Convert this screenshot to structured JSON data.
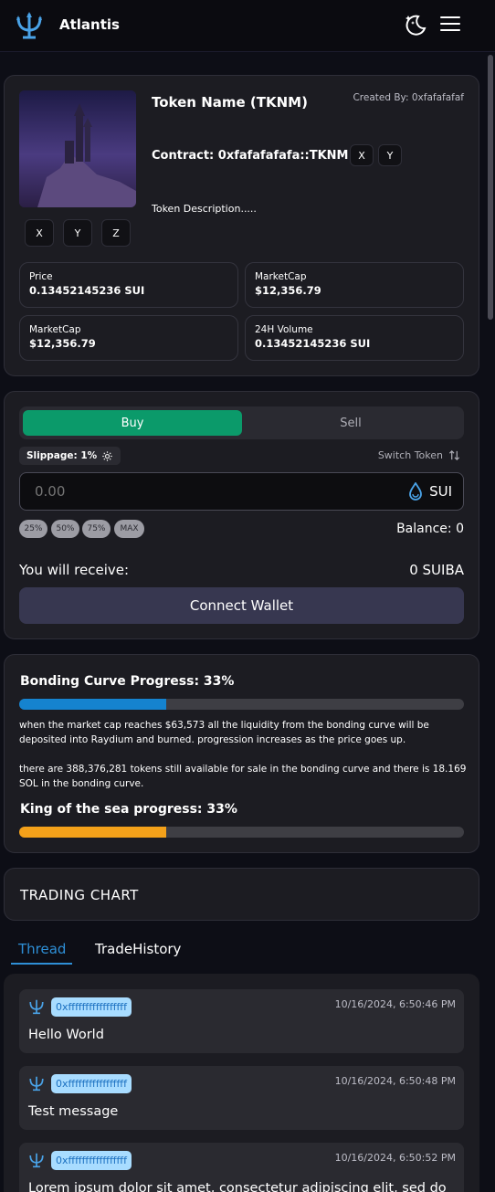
{
  "header": {
    "title": "Atlantis",
    "logo_icon": "trident-icon",
    "theme_icon": "moon-stars-icon",
    "menu_icon": "hamburger-menu-icon"
  },
  "token": {
    "name": "Token Name (TKNM)",
    "created_by": "Created By: 0xfafafafaf",
    "contract": "Contract: 0xfafafafafa::TKNM",
    "contract_links": [
      "X",
      "Y"
    ],
    "social_links": [
      "X",
      "Y",
      "Z"
    ],
    "description": "Token Description.....",
    "stats": [
      {
        "label": "Price",
        "value": "0.13452145236 SUI"
      },
      {
        "label": "MarketCap",
        "value": "$12,356.79"
      },
      {
        "label": "MarketCap",
        "value": "$12,356.79"
      },
      {
        "label": "24H Volume",
        "value": "0.13452145236 SUI"
      }
    ]
  },
  "trade": {
    "buy_label": "Buy",
    "sell_label": "Sell",
    "active_tab": "Buy",
    "slippage": "Slippage: 1%",
    "switch_token": "Switch Token",
    "amount_placeholder": "0.00",
    "currency": "SUI",
    "quick_amounts": [
      "25%",
      "50%",
      "75%",
      "MAX"
    ],
    "balance": "Balance: 0",
    "receive_label": "You will receive:",
    "receive_value": "0 SUIBA",
    "connect_label": "Connect Wallet"
  },
  "bonding": {
    "title": "Bonding Curve Progress: 33%",
    "progress": 0.33,
    "progress_color": "#1583cf",
    "text1": "when the market cap reaches $63,573 all the liquidity from the bonding curve will be deposited into Raydium and burned. progression increases as the price goes up.",
    "text2": "there are 388,376,281 tokens still available for sale in the bonding curve and there is 18.169 SOL in the bonding curve.",
    "king_title": "King of the sea progress: 33%",
    "king_progress": 0.33,
    "king_color": "#f4a11a"
  },
  "chart": {
    "title": "TRADING CHART"
  },
  "tabs": {
    "thread": "Thread",
    "trade_history": "TradeHistory",
    "active": "Thread"
  },
  "messages": [
    {
      "user": "0xfffffffffffffffff",
      "time": "10/16/2024, 6:50:46 PM",
      "text": "Hello World"
    },
    {
      "user": "0xfffffffffffffffff",
      "time": "10/16/2024, 6:50:48 PM",
      "text": "Test message"
    },
    {
      "user": "0xfffffffffffffffff",
      "time": "10/16/2024, 6:50:52 PM",
      "text": "Lorem ipsum dolor sit amet, consectetur adipiscing elit, sed do"
    }
  ],
  "colors": {
    "accent_blue": "#2e8fd6",
    "buy_green": "#0b9a6a",
    "background": "#0d0e16",
    "card": "#1c1c22"
  }
}
